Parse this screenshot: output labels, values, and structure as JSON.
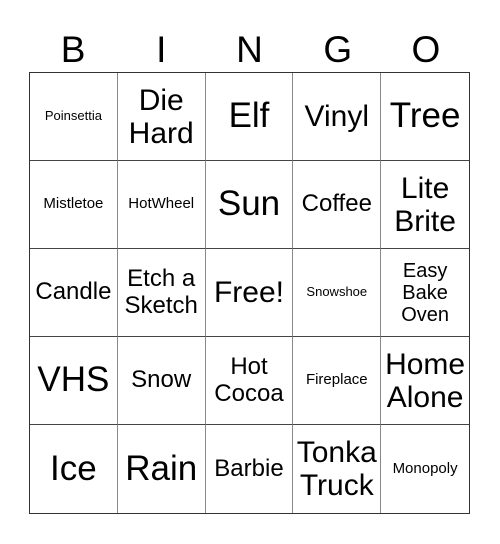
{
  "header": [
    "B",
    "I",
    "N",
    "G",
    "O"
  ],
  "cells": [
    {
      "text": "Poinsettia",
      "size": "s-xxs"
    },
    {
      "text": "Die Hard",
      "size": "s-l"
    },
    {
      "text": "Elf",
      "size": "s-xl"
    },
    {
      "text": "Vinyl",
      "size": "s-l"
    },
    {
      "text": "Tree",
      "size": "s-xl"
    },
    {
      "text": "Mistletoe",
      "size": "s-xs"
    },
    {
      "text": "HotWheel",
      "size": "s-xs"
    },
    {
      "text": "Sun",
      "size": "s-xl"
    },
    {
      "text": "Coffee",
      "size": "s-m"
    },
    {
      "text": "Lite Brite",
      "size": "s-l"
    },
    {
      "text": "Candle",
      "size": "s-m"
    },
    {
      "text": "Etch a Sketch",
      "size": "s-m"
    },
    {
      "text": "Free!",
      "size": "s-l"
    },
    {
      "text": "Snowshoe",
      "size": "s-xxs"
    },
    {
      "text": "Easy Bake Oven",
      "size": "s-sm"
    },
    {
      "text": "VHS",
      "size": "s-xl"
    },
    {
      "text": "Snow",
      "size": "s-m"
    },
    {
      "text": "Hot Cocoa",
      "size": "s-m"
    },
    {
      "text": "Fireplace",
      "size": "s-xs"
    },
    {
      "text": "Home Alone",
      "size": "s-l"
    },
    {
      "text": "Ice",
      "size": "s-xl"
    },
    {
      "text": "Rain",
      "size": "s-xl"
    },
    {
      "text": "Barbie",
      "size": "s-m"
    },
    {
      "text": "Tonka Truck",
      "size": "s-l"
    },
    {
      "text": "Monopoly",
      "size": "s-xs"
    }
  ]
}
